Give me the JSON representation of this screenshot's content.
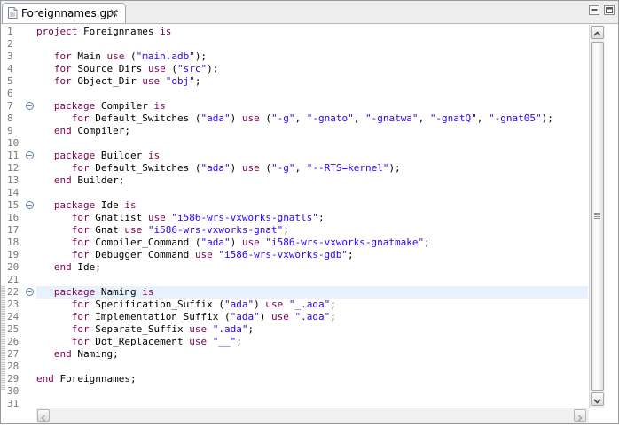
{
  "tab": {
    "label": "Foreignnames.gpr",
    "close_glyph": "x"
  },
  "colors": {
    "keyword": "#7f0055",
    "string": "#2a00ff",
    "current_line": "#e8f2fe",
    "line_number": "#7a7a7a"
  },
  "editor": {
    "current_line": 22,
    "fold_lines": [
      7,
      11,
      15,
      22
    ],
    "lines": [
      [
        {
          "t": "kw",
          "v": "project"
        },
        {
          "t": "p",
          "v": " Foreignnames "
        },
        {
          "t": "kw",
          "v": "is"
        }
      ],
      [],
      [
        {
          "t": "p",
          "v": "   "
        },
        {
          "t": "kw",
          "v": "for"
        },
        {
          "t": "p",
          "v": " Main "
        },
        {
          "t": "kw",
          "v": "use"
        },
        {
          "t": "p",
          "v": " ("
        },
        {
          "t": "str",
          "v": "\"main.adb\""
        },
        {
          "t": "p",
          "v": ");"
        }
      ],
      [
        {
          "t": "p",
          "v": "   "
        },
        {
          "t": "kw",
          "v": "for"
        },
        {
          "t": "p",
          "v": " Source_Dirs "
        },
        {
          "t": "kw",
          "v": "use"
        },
        {
          "t": "p",
          "v": " ("
        },
        {
          "t": "str",
          "v": "\"src\""
        },
        {
          "t": "p",
          "v": ");"
        }
      ],
      [
        {
          "t": "p",
          "v": "   "
        },
        {
          "t": "kw",
          "v": "for"
        },
        {
          "t": "p",
          "v": " Object_Dir "
        },
        {
          "t": "kw",
          "v": "use"
        },
        {
          "t": "p",
          "v": " "
        },
        {
          "t": "str",
          "v": "\"obj\""
        },
        {
          "t": "p",
          "v": ";"
        }
      ],
      [],
      [
        {
          "t": "p",
          "v": "   "
        },
        {
          "t": "kw",
          "v": "package"
        },
        {
          "t": "p",
          "v": " Compiler "
        },
        {
          "t": "kw",
          "v": "is"
        }
      ],
      [
        {
          "t": "p",
          "v": "      "
        },
        {
          "t": "kw",
          "v": "for"
        },
        {
          "t": "p",
          "v": " Default_Switches ("
        },
        {
          "t": "str",
          "v": "\"ada\""
        },
        {
          "t": "p",
          "v": ") "
        },
        {
          "t": "kw",
          "v": "use"
        },
        {
          "t": "p",
          "v": " ("
        },
        {
          "t": "str",
          "v": "\"-g\""
        },
        {
          "t": "p",
          "v": ", "
        },
        {
          "t": "str",
          "v": "\"-gnato\""
        },
        {
          "t": "p",
          "v": ", "
        },
        {
          "t": "str",
          "v": "\"-gnatwa\""
        },
        {
          "t": "p",
          "v": ", "
        },
        {
          "t": "str",
          "v": "\"-gnatQ\""
        },
        {
          "t": "p",
          "v": ", "
        },
        {
          "t": "str",
          "v": "\"-gnat05\""
        },
        {
          "t": "p",
          "v": ");"
        }
      ],
      [
        {
          "t": "p",
          "v": "   "
        },
        {
          "t": "kw",
          "v": "end"
        },
        {
          "t": "p",
          "v": " Compiler;"
        }
      ],
      [],
      [
        {
          "t": "p",
          "v": "   "
        },
        {
          "t": "kw",
          "v": "package"
        },
        {
          "t": "p",
          "v": " Builder "
        },
        {
          "t": "kw",
          "v": "is"
        }
      ],
      [
        {
          "t": "p",
          "v": "      "
        },
        {
          "t": "kw",
          "v": "for"
        },
        {
          "t": "p",
          "v": " Default_Switches ("
        },
        {
          "t": "str",
          "v": "\"ada\""
        },
        {
          "t": "p",
          "v": ") "
        },
        {
          "t": "kw",
          "v": "use"
        },
        {
          "t": "p",
          "v": " ("
        },
        {
          "t": "str",
          "v": "\"-g\""
        },
        {
          "t": "p",
          "v": ", "
        },
        {
          "t": "str",
          "v": "\"--RTS=kernel\""
        },
        {
          "t": "p",
          "v": ");"
        }
      ],
      [
        {
          "t": "p",
          "v": "   "
        },
        {
          "t": "kw",
          "v": "end"
        },
        {
          "t": "p",
          "v": " Builder;"
        }
      ],
      [],
      [
        {
          "t": "p",
          "v": "   "
        },
        {
          "t": "kw",
          "v": "package"
        },
        {
          "t": "p",
          "v": " Ide "
        },
        {
          "t": "kw",
          "v": "is"
        }
      ],
      [
        {
          "t": "p",
          "v": "      "
        },
        {
          "t": "kw",
          "v": "for"
        },
        {
          "t": "p",
          "v": " Gnatlist "
        },
        {
          "t": "kw",
          "v": "use"
        },
        {
          "t": "p",
          "v": " "
        },
        {
          "t": "str",
          "v": "\"i586-wrs-vxworks-gnatls\""
        },
        {
          "t": "p",
          "v": ";"
        }
      ],
      [
        {
          "t": "p",
          "v": "      "
        },
        {
          "t": "kw",
          "v": "for"
        },
        {
          "t": "p",
          "v": " Gnat "
        },
        {
          "t": "kw",
          "v": "use"
        },
        {
          "t": "p",
          "v": " "
        },
        {
          "t": "str",
          "v": "\"i586-wrs-vxworks-gnat\""
        },
        {
          "t": "p",
          "v": ";"
        }
      ],
      [
        {
          "t": "p",
          "v": "      "
        },
        {
          "t": "kw",
          "v": "for"
        },
        {
          "t": "p",
          "v": " Compiler_Command ("
        },
        {
          "t": "str",
          "v": "\"ada\""
        },
        {
          "t": "p",
          "v": ") "
        },
        {
          "t": "kw",
          "v": "use"
        },
        {
          "t": "p",
          "v": " "
        },
        {
          "t": "str",
          "v": "\"i586-wrs-vxworks-gnatmake\""
        },
        {
          "t": "p",
          "v": ";"
        }
      ],
      [
        {
          "t": "p",
          "v": "      "
        },
        {
          "t": "kw",
          "v": "for"
        },
        {
          "t": "p",
          "v": " Debugger_Command "
        },
        {
          "t": "kw",
          "v": "use"
        },
        {
          "t": "p",
          "v": " "
        },
        {
          "t": "str",
          "v": "\"i586-wrs-vxworks-gdb\""
        },
        {
          "t": "p",
          "v": ";"
        }
      ],
      [
        {
          "t": "p",
          "v": "   "
        },
        {
          "t": "kw",
          "v": "end"
        },
        {
          "t": "p",
          "v": " Ide;"
        }
      ],
      [],
      [
        {
          "t": "p",
          "v": "   "
        },
        {
          "t": "kw",
          "v": "package"
        },
        {
          "t": "p",
          "v": " Naming "
        },
        {
          "t": "kw",
          "v": "is"
        }
      ],
      [
        {
          "t": "p",
          "v": "      "
        },
        {
          "t": "kw",
          "v": "for"
        },
        {
          "t": "p",
          "v": " Specification_Suffix ("
        },
        {
          "t": "str",
          "v": "\"ada\""
        },
        {
          "t": "p",
          "v": ") "
        },
        {
          "t": "kw",
          "v": "use"
        },
        {
          "t": "p",
          "v": " "
        },
        {
          "t": "str",
          "v": "\"_.ada\""
        },
        {
          "t": "p",
          "v": ";"
        }
      ],
      [
        {
          "t": "p",
          "v": "      "
        },
        {
          "t": "kw",
          "v": "for"
        },
        {
          "t": "p",
          "v": " Implementation_Suffix ("
        },
        {
          "t": "str",
          "v": "\"ada\""
        },
        {
          "t": "p",
          "v": ") "
        },
        {
          "t": "kw",
          "v": "use"
        },
        {
          "t": "p",
          "v": " "
        },
        {
          "t": "str",
          "v": "\".ada\""
        },
        {
          "t": "p",
          "v": ";"
        }
      ],
      [
        {
          "t": "p",
          "v": "      "
        },
        {
          "t": "kw",
          "v": "for"
        },
        {
          "t": "p",
          "v": " Separate_Suffix "
        },
        {
          "t": "kw",
          "v": "use"
        },
        {
          "t": "p",
          "v": " "
        },
        {
          "t": "str",
          "v": "\".ada\""
        },
        {
          "t": "p",
          "v": ";"
        }
      ],
      [
        {
          "t": "p",
          "v": "      "
        },
        {
          "t": "kw",
          "v": "for"
        },
        {
          "t": "p",
          "v": " Dot_Replacement "
        },
        {
          "t": "kw",
          "v": "use"
        },
        {
          "t": "p",
          "v": " "
        },
        {
          "t": "str",
          "v": "\"__\""
        },
        {
          "t": "p",
          "v": ";"
        }
      ],
      [
        {
          "t": "p",
          "v": "   "
        },
        {
          "t": "kw",
          "v": "end"
        },
        {
          "t": "p",
          "v": " Naming;"
        }
      ],
      [],
      [
        {
          "t": "kw",
          "v": "end"
        },
        {
          "t": "p",
          "v": " Foreignnames;"
        }
      ],
      [],
      []
    ]
  }
}
